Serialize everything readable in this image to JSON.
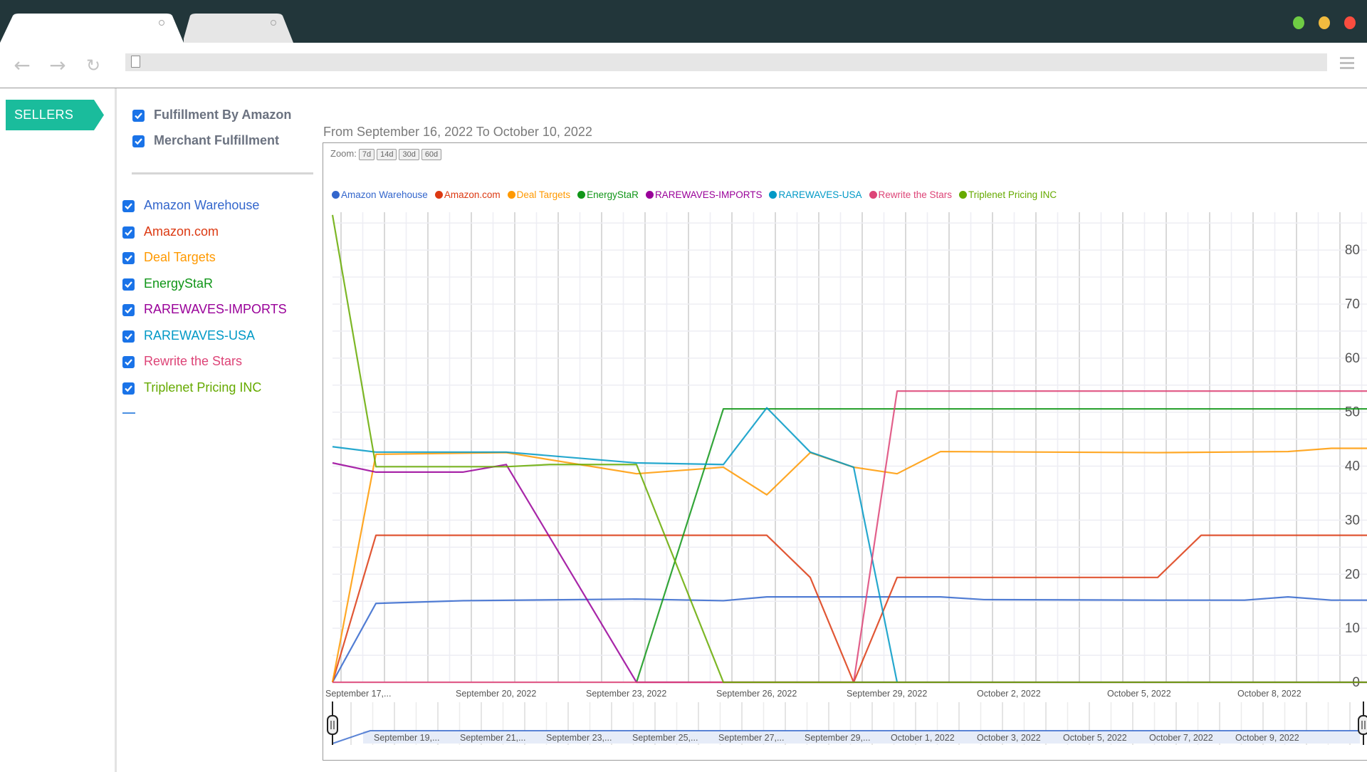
{
  "browser": {
    "tabs": [
      {
        "label": ""
      },
      {
        "label": ""
      }
    ],
    "address": "",
    "window_controls": {
      "maximize_color": "#6fcc44",
      "minimize_color": "#f1bb3f",
      "close_color": "#fb4d3f"
    }
  },
  "sidebar": {
    "tag_label": "SELLERS",
    "tag_color": "#1abc9c",
    "fulfillment": [
      {
        "label": "Fulfillment By Amazon",
        "checked": true
      },
      {
        "label": "Merchant Fulfillment",
        "checked": true
      }
    ],
    "sellers": [
      {
        "label": "Amazon Warehouse",
        "checked": true,
        "color": "#3366cc"
      },
      {
        "label": "Amazon.com",
        "checked": true,
        "color": "#dc3912"
      },
      {
        "label": "Deal Targets",
        "checked": true,
        "color": "#ff9900"
      },
      {
        "label": "EnergyStaR",
        "checked": true,
        "color": "#109618"
      },
      {
        "label": "RAREWAVES-IMPORTS",
        "checked": true,
        "color": "#990099"
      },
      {
        "label": "RAREWAVES-USA",
        "checked": true,
        "color": "#0099c6"
      },
      {
        "label": "Rewrite the Stars",
        "checked": true,
        "color": "#dd4477"
      },
      {
        "label": "Triplenet Pricing INC",
        "checked": true,
        "color": "#66aa00"
      }
    ]
  },
  "main": {
    "range_title": "From September 16, 2022 To October 10, 2022",
    "zoom_label": "Zoom:",
    "zoom_buttons": [
      "7d",
      "14d",
      "30d",
      "60d"
    ]
  },
  "chart_data": {
    "type": "line",
    "title": "From September 16, 2022 To October 10, 2022",
    "xlabel": "",
    "ylabel": "",
    "x_start": "2022-09-17",
    "x_unit": "day",
    "xlim_days": [
      0,
      24
    ],
    "ylim": [
      0,
      87
    ],
    "y_ticks": [
      0,
      10,
      20,
      30,
      40,
      50,
      60,
      70,
      80
    ],
    "y_axis_position": "right",
    "grid": true,
    "legend_position": "top",
    "x_tick_labels": [
      {
        "day": 0,
        "label": "September 17,..."
      },
      {
        "day": 3,
        "label": "September 20, 2022"
      },
      {
        "day": 6,
        "label": "September 23, 2022"
      },
      {
        "day": 9,
        "label": "September 26, 2022"
      },
      {
        "day": 12,
        "label": "September 29, 2022"
      },
      {
        "day": 15,
        "label": "October 2, 2022"
      },
      {
        "day": 18,
        "label": "October 5, 2022"
      },
      {
        "day": 21,
        "label": "October 8, 2022"
      }
    ],
    "navigator_labels": [
      {
        "day": 2,
        "label": "September 19,..."
      },
      {
        "day": 4,
        "label": "September 21,..."
      },
      {
        "day": 6,
        "label": "September 23,..."
      },
      {
        "day": 8,
        "label": "September 25,..."
      },
      {
        "day": 10,
        "label": "September 27,..."
      },
      {
        "day": 12,
        "label": "September 29,..."
      },
      {
        "day": 14,
        "label": "October 1, 2022"
      },
      {
        "day": 16,
        "label": "October 3, 2022"
      },
      {
        "day": 18,
        "label": "October 5, 2022"
      },
      {
        "day": 20,
        "label": "October 7, 2022"
      },
      {
        "day": 22,
        "label": "October 9, 2022"
      }
    ],
    "series": [
      {
        "name": "Amazon Warehouse",
        "color": "#3366cc",
        "points": [
          [
            0,
            0
          ],
          [
            1,
            14.6
          ],
          [
            3,
            15.1
          ],
          [
            7,
            15.4
          ],
          [
            9,
            15.1
          ],
          [
            10,
            15.8
          ],
          [
            14,
            15.8
          ],
          [
            15,
            15.3
          ],
          [
            19,
            15.2
          ],
          [
            21,
            15.2
          ],
          [
            22,
            15.8
          ],
          [
            23,
            15.2
          ],
          [
            24,
            15.2
          ]
        ]
      },
      {
        "name": "Amazon.com",
        "color": "#dc3912",
        "points": [
          [
            0,
            0
          ],
          [
            1,
            27.2
          ],
          [
            10,
            27.2
          ],
          [
            11,
            19.4
          ],
          [
            12,
            0
          ],
          [
            13,
            19.4
          ],
          [
            19,
            19.4
          ],
          [
            20,
            27.2
          ],
          [
            24,
            27.2
          ]
        ]
      },
      {
        "name": "Deal Targets",
        "color": "#ff9900",
        "points": [
          [
            0,
            0
          ],
          [
            1,
            42.2
          ],
          [
            4,
            42.5
          ],
          [
            7,
            38.6
          ],
          [
            9,
            39.8
          ],
          [
            10,
            34.7
          ],
          [
            11,
            42.5
          ],
          [
            12,
            39.8
          ],
          [
            13,
            38.6
          ],
          [
            14,
            42.7
          ],
          [
            19,
            42.5
          ],
          [
            22,
            42.7
          ],
          [
            23,
            43.3
          ],
          [
            24,
            43.3
          ]
        ]
      },
      {
        "name": "EnergyStaR",
        "color": "#109618",
        "points": [
          [
            7,
            0
          ],
          [
            9,
            50.6
          ],
          [
            24,
            50.6
          ]
        ]
      },
      {
        "name": "RAREWAVES-IMPORTS",
        "color": "#990099",
        "points": [
          [
            0,
            40.6
          ],
          [
            1,
            38.9
          ],
          [
            3,
            38.9
          ],
          [
            4,
            40.3
          ],
          [
            7,
            0
          ],
          [
            24,
            0
          ]
        ]
      },
      {
        "name": "RAREWAVES-USA",
        "color": "#0099c6",
        "points": [
          [
            0,
            43.6
          ],
          [
            1,
            42.6
          ],
          [
            4,
            42.6
          ],
          [
            7,
            40.6
          ],
          [
            9,
            40.3
          ],
          [
            10,
            50.8
          ],
          [
            11,
            42.6
          ],
          [
            12,
            39.8
          ],
          [
            13,
            0
          ]
        ]
      },
      {
        "name": "Rewrite the Stars",
        "color": "#dd4477",
        "points": [
          [
            0,
            0
          ],
          [
            12,
            0
          ],
          [
            13,
            53.9
          ],
          [
            24,
            53.9
          ]
        ]
      },
      {
        "name": "Triplenet Pricing INC",
        "color": "#66aa00",
        "points": [
          [
            0,
            86.5
          ],
          [
            1,
            39.9
          ],
          [
            4,
            39.9
          ],
          [
            5,
            40.3
          ],
          [
            7,
            40.3
          ],
          [
            9,
            0
          ],
          [
            24,
            0
          ]
        ]
      }
    ]
  }
}
